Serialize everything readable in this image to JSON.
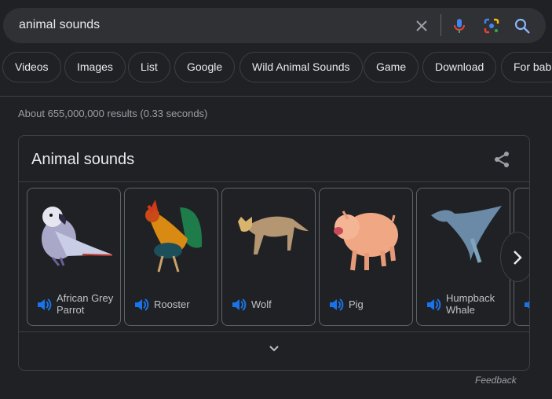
{
  "search": {
    "query": "animal sounds",
    "icons": [
      "close-icon",
      "microphone-icon",
      "lens-icon",
      "search-icon"
    ]
  },
  "chips": [
    "Videos",
    "Images",
    "List",
    "Google",
    "Wild Animal Sounds",
    "Game",
    "Download",
    "For babi"
  ],
  "stats": "About 655,000,000 results (0.33 seconds)",
  "panel": {
    "title": "Animal sounds",
    "cards": [
      {
        "line1": "African Grey",
        "line2": "Parrot"
      },
      {
        "line1": "Rooster",
        "line2": ""
      },
      {
        "line1": "Wolf",
        "line2": ""
      },
      {
        "line1": "Pig",
        "line2": ""
      },
      {
        "line1": "Humpback",
        "line2": "Whale"
      }
    ]
  },
  "feedback": "Feedback",
  "colors": {
    "background": "#202124",
    "speaker": "#1a73e8"
  }
}
